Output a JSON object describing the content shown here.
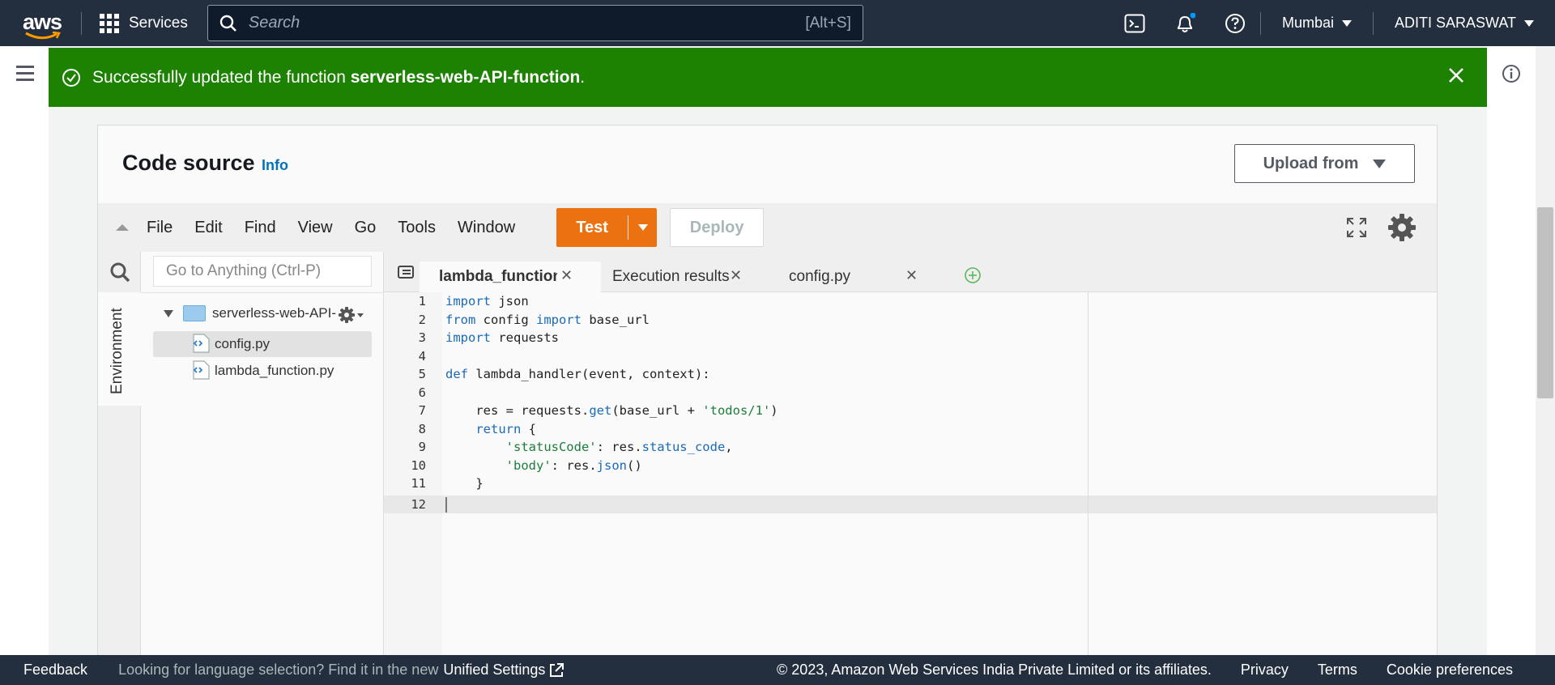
{
  "nav": {
    "logo": "aws",
    "services_label": "Services",
    "search_placeholder": "Search",
    "search_shortcut": "[Alt+S]",
    "region": "Mumbai",
    "user": "ADITI SARASWAT"
  },
  "flash": {
    "message_prefix": "Successfully updated the function ",
    "function_name": "serverless-web-API-function",
    "message_suffix": "."
  },
  "panel": {
    "title": "Code source",
    "info": "Info",
    "upload": "Upload from"
  },
  "ide": {
    "menu": [
      "File",
      "Edit",
      "Find",
      "View",
      "Go",
      "Tools",
      "Window"
    ],
    "test": "Test",
    "deploy": "Deploy",
    "goto_placeholder": "Go to Anything (Ctrl-P)",
    "environment_tab": "Environment",
    "folder": "serverless-web-API-",
    "files": [
      "config.py",
      "lambda_function.py"
    ],
    "tabs": [
      "lambda_function",
      "Execution results",
      "config.py"
    ]
  },
  "code": {
    "line_numbers": [
      "1",
      "2",
      "3",
      "4",
      "5",
      "6",
      "7",
      "8",
      "9",
      "10",
      "11",
      "12"
    ]
  },
  "footer": {
    "feedback": "Feedback",
    "lang_prompt": "Looking for language selection? Find it in the new",
    "unified": "Unified Settings",
    "copyright": "© 2023, Amazon Web Services India Private Limited or its affiliates.",
    "privacy": "Privacy",
    "terms": "Terms",
    "cookies": "Cookie preferences"
  },
  "colors": {
    "nav_bg": "#232f3e",
    "flash_green": "#1d8102",
    "test_orange": "#ec7211",
    "link_blue": "#0073bb"
  }
}
